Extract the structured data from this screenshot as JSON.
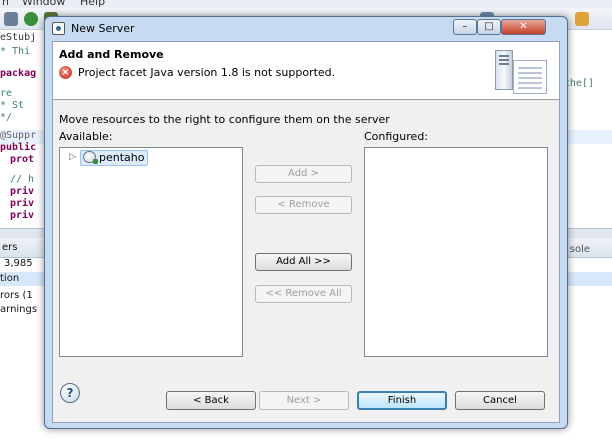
{
  "ide": {
    "menu": [
      "n",
      "Window",
      "Help"
    ],
    "code_lines": [
      "eStubj",
      "* Thi",
      "packag",
      "re",
      "* St",
      "*/",
      "",
      "@Suppr",
      "public",
      "prot",
      "",
      "// h",
      "priv",
      "priv",
      "priv"
    ],
    "right_text": "the[]",
    "panel_lines": [
      "ers",
      "3,985",
      "tion",
      "rors (1",
      "arnings"
    ],
    "panel_right": "sole"
  },
  "dialog": {
    "title": "New Server",
    "window_controls": {
      "minimize": "–",
      "maximize": "□",
      "close": "✕"
    },
    "header": {
      "title": "Add and Remove",
      "error_message": "Project facet Java version 1.8 is not supported.",
      "error_icon": "error-icon"
    },
    "description": "Move resources to the right to configure them on the server",
    "available_label": "Available:",
    "configured_label": "Configured:",
    "available_items": [
      {
        "label": "pentaho",
        "icon": "project-icon",
        "selected": true
      }
    ],
    "configured_items": [],
    "buttons": {
      "add": "Add >",
      "remove": "< Remove",
      "add_all": "Add All >>",
      "remove_all": "<< Remove All",
      "help": "?",
      "back": "< Back",
      "next": "Next >",
      "finish": "Finish",
      "cancel": "Cancel"
    }
  },
  "colors": {
    "dialog_frame": "#c6dbf2",
    "error": "#c4291b",
    "selection": "#dcebfc",
    "default_button_border": "#3c7fb1"
  }
}
